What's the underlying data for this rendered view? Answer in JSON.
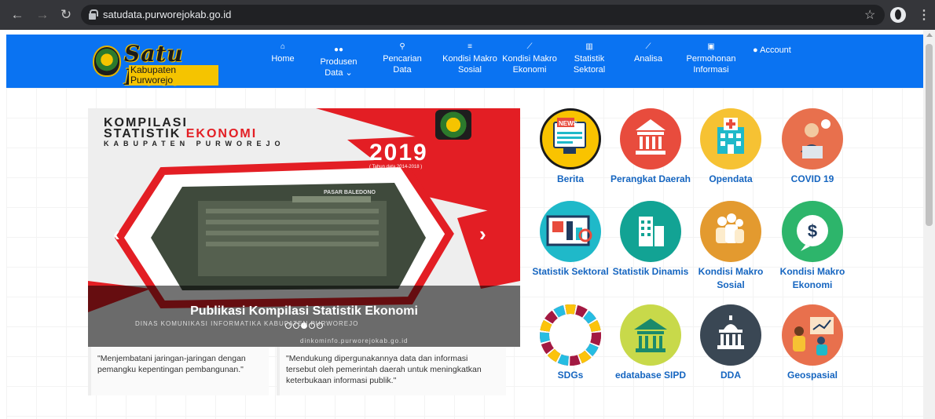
{
  "browser": {
    "url": "satudata.purworejokab.go.id"
  },
  "logo": {
    "title": "Satu Data",
    "subtitle": "Kabupaten Purworejo"
  },
  "menu": [
    {
      "line1": "Home",
      "line2": ""
    },
    {
      "line1": "Produsen",
      "line2": "Data ⌄"
    },
    {
      "line1": "Pencarian",
      "line2": "Data"
    },
    {
      "line1": "Kondisi Makro",
      "line2": "Sosial"
    },
    {
      "line1": "Kondisi Makro",
      "line2": "Ekonomi"
    },
    {
      "line1": "Statistik",
      "line2": "Sektoral"
    },
    {
      "line1": "Analisa",
      "line2": ""
    },
    {
      "line1": "Permohonan",
      "line2": "Informasi"
    }
  ],
  "account_label": "Account",
  "carousel": {
    "cover_line1": "KOMPILASI",
    "cover_line2_a": "STATISTIK ",
    "cover_line2_b": "EKONOMI",
    "cover_line3": "KABUPATEN PURWOREJO",
    "cover_year": "2019",
    "cover_years_note": "( Tahun data 2014-2018 )",
    "building_sign": "PASAR BALEDONO",
    "caption": "Publikasi Kompilasi Statistik Ekonomi",
    "footer_text": "DINAS KOMUNIKASI INFORMATIKA KABUPATEN PURWOREJO",
    "footer_handles": "dinkominfo.purworejokab.go.id",
    "prev": "‹",
    "next": "›"
  },
  "quotes": [
    "\"Menjembatani jaringan-jaringan dengan pemangku kepentingan pembangunan.\"",
    "\"Mendukung dipergunakannya data dan informasi tersebut oleh pemerintah daerah untuk meningkatkan keterbukaan informasi publik.\""
  ],
  "tiles": [
    {
      "label": "Berita",
      "icon": "news-icon",
      "color": "#f9c300"
    },
    {
      "label": "Perangkat Daerah",
      "icon": "government-building-icon",
      "color": "#e84c3d"
    },
    {
      "label": "Opendata",
      "icon": "hospital-icon",
      "color": "#f6c233"
    },
    {
      "label": "COVID 19",
      "icon": "call-center-icon",
      "color": "#e8704d"
    },
    {
      "label": "Statistik Sektoral",
      "icon": "data-analysis-icon",
      "color": "#1fb9c9"
    },
    {
      "label": "Statistik Dinamis",
      "icon": "office-building-icon",
      "color": "#12a394"
    },
    {
      "label": "Kondisi Makro Sosial",
      "icon": "people-group-icon",
      "color": "#e39a2f"
    },
    {
      "label": "Kondisi Makro Ekonomi",
      "icon": "dollar-icon",
      "color": "#2db56b"
    },
    {
      "label": "SDGs",
      "icon": "sdgs-wheel-icon",
      "color": "#ffffff"
    },
    {
      "label": "edatabase SIPD",
      "icon": "bank-icon",
      "color": "#c8d94a"
    },
    {
      "label": "DDA",
      "icon": "capitol-icon",
      "color": "#3a4754"
    },
    {
      "label": "Geospasial",
      "icon": "presentation-icon",
      "color": "#e8704d"
    }
  ],
  "colors": {
    "header_blue": "#0a73f2",
    "link_blue": "#1565c0",
    "accent_red": "#e31e24"
  }
}
